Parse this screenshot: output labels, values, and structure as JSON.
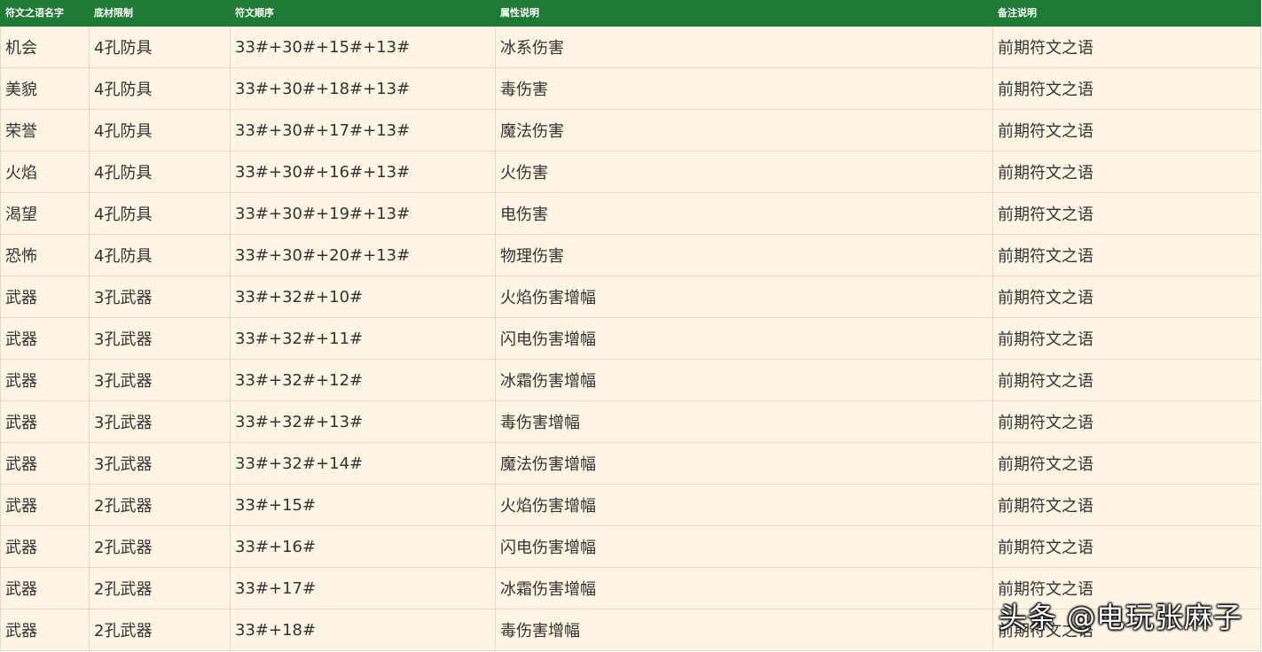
{
  "table": {
    "headers": [
      "符文之语名字",
      "底材限制",
      "符文顺序",
      "属性说明",
      "备注说明"
    ],
    "rows": [
      [
        "机会",
        "4孔防具",
        "33#+30#+15#+13#",
        "冰系伤害",
        "前期符文之语"
      ],
      [
        "美貌",
        "4孔防具",
        "33#+30#+18#+13#",
        "毒伤害",
        "前期符文之语"
      ],
      [
        "荣誉",
        "4孔防具",
        "33#+30#+17#+13#",
        "魔法伤害",
        "前期符文之语"
      ],
      [
        "火焰",
        "4孔防具",
        "33#+30#+16#+13#",
        "火伤害",
        "前期符文之语"
      ],
      [
        "渴望",
        "4孔防具",
        "33#+30#+19#+13#",
        "电伤害",
        "前期符文之语"
      ],
      [
        "恐怖",
        "4孔防具",
        "33#+30#+20#+13#",
        "物理伤害",
        "前期符文之语"
      ],
      [
        "武器",
        "3孔武器",
        "33#+32#+10#",
        "火焰伤害增幅",
        "前期符文之语"
      ],
      [
        "武器",
        "3孔武器",
        "33#+32#+11#",
        "闪电伤害增幅",
        "前期符文之语"
      ],
      [
        "武器",
        "3孔武器",
        "33#+32#+12#",
        "冰霜伤害增幅",
        "前期符文之语"
      ],
      [
        "武器",
        "3孔武器",
        "33#+32#+13#",
        "毒伤害增幅",
        "前期符文之语"
      ],
      [
        "武器",
        "3孔武器",
        "33#+32#+14#",
        "魔法伤害增幅",
        "前期符文之语"
      ],
      [
        "武器",
        "2孔武器",
        "33#+15#",
        "火焰伤害增幅",
        "前期符文之语"
      ],
      [
        "武器",
        "2孔武器",
        "33#+16#",
        "闪电伤害增幅",
        "前期符文之语"
      ],
      [
        "武器",
        "2孔武器",
        "33#+17#",
        "冰霜伤害增幅",
        "前期符文之语"
      ],
      [
        "武器",
        "2孔武器",
        "33#+18#",
        "毒伤害增幅",
        "前期符文之语"
      ]
    ]
  },
  "watermark": "头条 @电玩张麻子",
  "colors": {
    "header_bg": "#1e7a34",
    "header_text": "#ffffff",
    "row_bg": "#fdf4e3",
    "cell_text": "#333333",
    "border": "#e3d9c6"
  }
}
